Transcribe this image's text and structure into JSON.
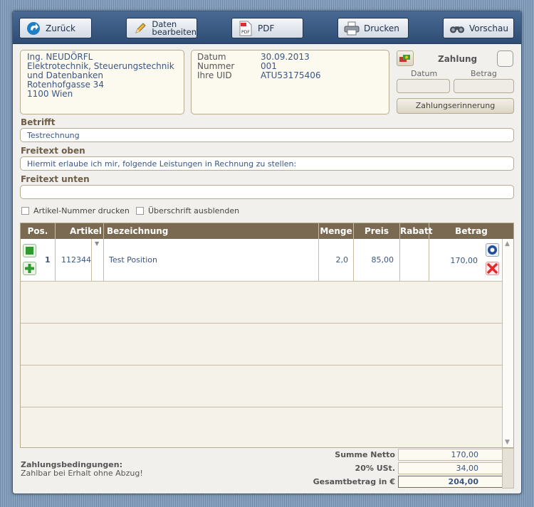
{
  "toolbar": {
    "back_label": "Zurück",
    "edit_label_line1": "Daten",
    "edit_label_line2": "bearbeiten",
    "pdf_label": "PDF",
    "print_label": "Drucken",
    "preview_label": "Vorschau"
  },
  "address": {
    "lines": [
      "Ing. NEUDÖRFL",
      "Elektrotechnik, Steuerungstechnik",
      "und Datenbanken",
      "Rotenhofgasse 34",
      "1100 Wien"
    ]
  },
  "meta": {
    "date_label": "Datum",
    "date_value": "30.09.2013",
    "number_label": "Nummer",
    "number_value": "001",
    "uid_label": "Ihre UID",
    "uid_value": "ATU53175406"
  },
  "payment": {
    "title": "Zahlung",
    "date_label": "Datum",
    "amount_label": "Betrag",
    "reminder_button": "Zahlungserinnerung"
  },
  "fields": {
    "subject_label": "Betrifft",
    "subject_value": "Testrechnung",
    "text_top_label": "Freitext oben",
    "text_top_value": "Hiermit erlaube ich mir, folgende Leistungen in Rechnung zu stellen:",
    "text_bottom_label": "Freitext unten",
    "text_bottom_value": ""
  },
  "options": {
    "print_article_number": "Artikel-Nummer drucken",
    "hide_heading": "Überschrift ausblenden"
  },
  "table": {
    "columns": [
      "Pos.",
      "Artikel",
      "Bezeichnung",
      "Menge",
      "Preis",
      "Rabatt",
      "Betrag"
    ],
    "rows": [
      {
        "pos": "1",
        "article": "112344",
        "description": "Test Position",
        "quantity": "2,0",
        "price": "85,00",
        "discount": "",
        "amount": "170,00"
      }
    ]
  },
  "totals": {
    "net_label": "Summe Netto",
    "net_value": "170,00",
    "vat_label": "20% USt.",
    "vat_value": "34,00",
    "gross_label": "Gesamtbetrag in €",
    "gross_value": "204,00"
  },
  "conditions": {
    "title": "Zahlungsbedingungen:",
    "text": "Zahlbar bei Erhalt ohne Abzug!"
  },
  "colors": {
    "toolbar": "#2e4c74",
    "table_header": "#7b6a52",
    "panel_bg": "#fcf9ee",
    "text_blue": "#3a5684"
  }
}
